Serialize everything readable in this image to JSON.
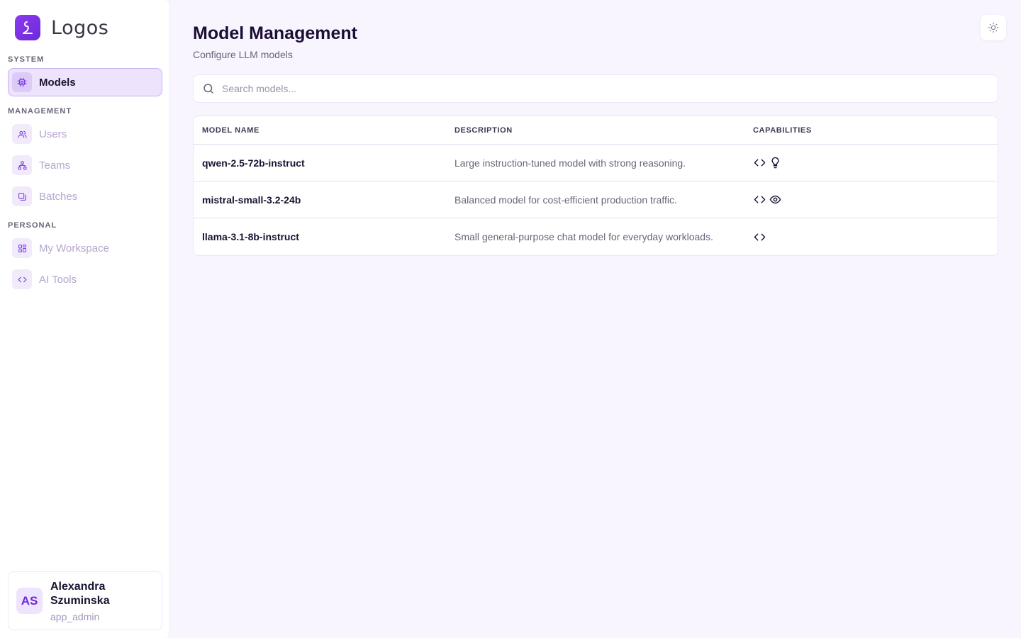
{
  "brand": {
    "name": "Logos"
  },
  "sidebar": {
    "sections": [
      {
        "label": "SYSTEM"
      },
      {
        "label": "MANAGEMENT"
      },
      {
        "label": "PERSONAL"
      }
    ],
    "items": [
      {
        "label": "Models",
        "icon": "chip-icon",
        "active": true
      },
      {
        "label": "Users",
        "icon": "users-icon",
        "active": false
      },
      {
        "label": "Teams",
        "icon": "teams-icon",
        "active": false
      },
      {
        "label": "Batches",
        "icon": "batches-icon",
        "active": false
      },
      {
        "label": "My Workspace",
        "icon": "workspace-icon",
        "active": false
      },
      {
        "label": "AI Tools",
        "icon": "code-icon",
        "active": false
      }
    ]
  },
  "user": {
    "initials": "AS",
    "name": "Alexandra Szuminska",
    "role": "app_admin"
  },
  "header": {
    "title": "Model Management",
    "subtitle": "Configure LLM models"
  },
  "search": {
    "placeholder": "Search models...",
    "value": ""
  },
  "table": {
    "columns": [
      "MODEL NAME",
      "DESCRIPTION",
      "CAPABILITIES"
    ],
    "rows": [
      {
        "name": "qwen-2.5-72b-instruct",
        "description": "Large instruction-tuned model with strong reasoning.",
        "capabilities": [
          "code-icon",
          "lightbulb-icon"
        ]
      },
      {
        "name": "mistral-small-3.2-24b",
        "description": "Balanced model for cost-efficient production traffic.",
        "capabilities": [
          "code-icon",
          "eye-icon"
        ]
      },
      {
        "name": "llama-3.1-8b-instruct",
        "description": "Small general-purpose chat model for everyday workloads.",
        "capabilities": [
          "code-icon"
        ]
      }
    ]
  },
  "theme_toggle": {
    "icon": "sun-icon"
  },
  "colors": {
    "accent": "#7c3aed",
    "background": "#f9f5fe",
    "sidebar_active_bg": "#ede3fc"
  }
}
